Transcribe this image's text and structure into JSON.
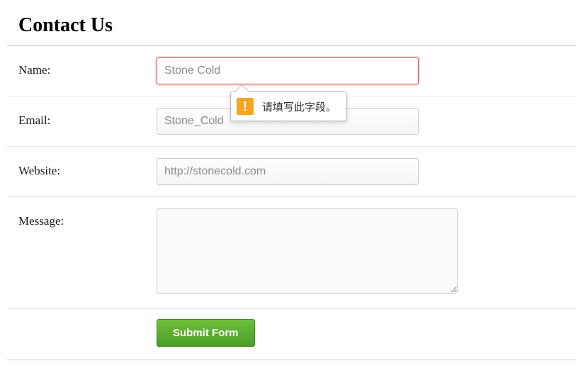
{
  "page_title": "Contact Us",
  "form": {
    "name": {
      "label": "Name:",
      "placeholder": "Stone Cold",
      "value": ""
    },
    "email": {
      "label": "Email:",
      "placeholder": "Stone_Cold",
      "value": ""
    },
    "website": {
      "label": "Website:",
      "placeholder": "http://stonecold.com",
      "value": ""
    },
    "message": {
      "label": "Message:",
      "value": ""
    },
    "submit_label": "Submit Form"
  },
  "validation": {
    "icon_glyph": "!",
    "message": "请填写此字段。"
  }
}
